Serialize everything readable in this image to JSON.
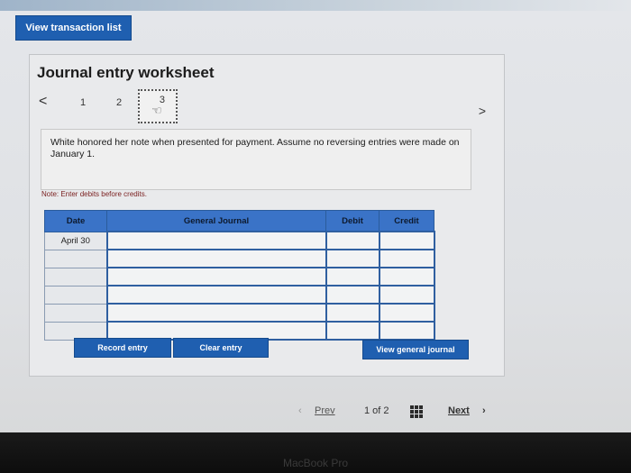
{
  "header": {
    "view_transactions_label": "View transaction list"
  },
  "worksheet": {
    "title": "Journal entry worksheet",
    "steps": [
      "1",
      "2",
      "3"
    ],
    "active_step": "3",
    "prev_glyph": "<",
    "next_glyph": ">",
    "prompt": "White honored her note when presented for payment. Assume no reversing entries were made on January 1.",
    "note": "Note: Enter debits before credits.",
    "table": {
      "headers": [
        "Date",
        "General Journal",
        "Debit",
        "Credit"
      ],
      "rows": [
        [
          "April 30",
          "",
          "",
          ""
        ],
        [
          "",
          "",
          "",
          ""
        ],
        [
          "",
          "",
          "",
          ""
        ],
        [
          "",
          "",
          "",
          ""
        ],
        [
          "",
          "",
          "",
          ""
        ],
        [
          "",
          "",
          "",
          ""
        ]
      ]
    },
    "buttons": {
      "record": "Record entry",
      "clear": "Clear entry",
      "view_general": "View general journal"
    }
  },
  "footer": {
    "prev": "Prev",
    "page": "1 of 2",
    "next": "Next"
  },
  "bezel": {
    "label": "MacBook Pro"
  }
}
